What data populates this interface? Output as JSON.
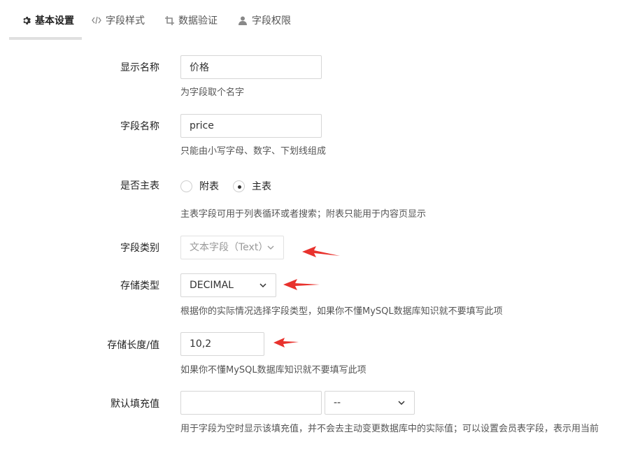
{
  "tabs": [
    {
      "label": "基本设置",
      "icon": "gear-icon"
    },
    {
      "label": "字段样式",
      "icon": "code-icon"
    },
    {
      "label": "数据验证",
      "icon": "crop-icon"
    },
    {
      "label": "字段权限",
      "icon": "user-icon"
    }
  ],
  "form": {
    "display_name": {
      "label": "显示名称",
      "value": "价格",
      "help": "为字段取个名字"
    },
    "field_name": {
      "label": "字段名称",
      "value": "price",
      "help": "只能由小写字母、数字、下划线组成"
    },
    "is_main_table": {
      "label": "是否主表",
      "options": [
        "附表",
        "主表"
      ],
      "selected": "主表",
      "help": "主表字段可用于列表循环或者搜索；附表只能用于内容页显示"
    },
    "field_type": {
      "label": "字段类别",
      "value": "文本字段（Text）"
    },
    "storage_type": {
      "label": "存储类型",
      "value": "DECIMAL",
      "help": "根据你的实际情况选择字段类型，如果你不懂MySQL数据库知识就不要填写此项"
    },
    "storage_length": {
      "label": "存储长度/值",
      "value": "10,2",
      "help": "如果你不懂MySQL数据库知识就不要填写此项"
    },
    "default_value": {
      "label": "默认填充值",
      "value": "",
      "select_value": "--",
      "help": "用于字段为空时显示该填充值，并不会去主动变更数据库中的实际值；可以设置会员表字段，表示用当前"
    }
  },
  "colors": {
    "annotation_arrow": "#e8322d",
    "accent": "#333333"
  }
}
